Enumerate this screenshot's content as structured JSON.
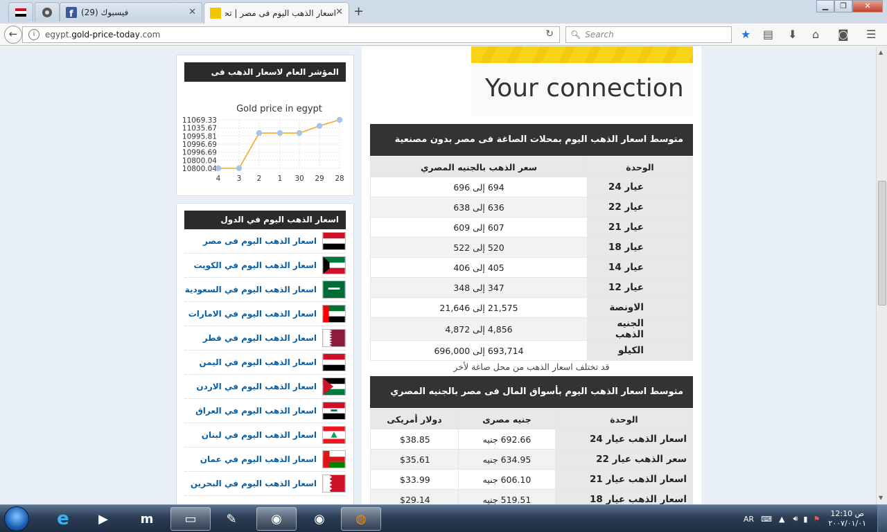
{
  "browser": {
    "tabs": [
      {
        "title": "",
        "favicon": "egypt-flag"
      },
      {
        "title": "",
        "favicon": "shield-icon"
      },
      {
        "title": "فيسبوك (29)",
        "favicon": "facebook-icon"
      },
      {
        "title": "اسعار الذهب اليوم فى مصر | تحديث",
        "favicon": "gold-square",
        "active": true
      }
    ],
    "url_prefix": "egypt.",
    "url_domain": "gold-price-today",
    "url_suffix": ".com",
    "search_placeholder": "Search"
  },
  "sidebar": {
    "chart_panel_title": "المؤشر العام لاسعار الذهب فى مصر",
    "countries_panel_title": "اسعار الذهب اليوم في الدول العربية",
    "countries": [
      {
        "label": "اسعار الذهب اليوم فى مصر",
        "flag": "egypt"
      },
      {
        "label": "اسعار الذهب اليوم في الكويت",
        "flag": "kuwait"
      },
      {
        "label": "اسعار الذهب اليوم في السعودية",
        "flag": "saudi"
      },
      {
        "label": "اسعار الذهب اليوم في الامارات",
        "flag": "uae"
      },
      {
        "label": "اسعار الذهب اليوم في قطر",
        "flag": "qatar"
      },
      {
        "label": "اسعار الذهب اليوم في اليمن",
        "flag": "yemen"
      },
      {
        "label": "اسعار الذهب اليوم في الاردن",
        "flag": "jordan"
      },
      {
        "label": "اسعار الذهب اليوم في العراق",
        "flag": "iraq"
      },
      {
        "label": "اسعار الذهب اليوم في لبنان",
        "flag": "lebanon"
      },
      {
        "label": "اسعار الذهب اليوم في عمان",
        "flag": "oman"
      },
      {
        "label": "اسعار الذهب اليوم في البحرين",
        "flag": "bahrain"
      }
    ]
  },
  "chart_data": {
    "type": "line",
    "title": "Gold price in egypt",
    "categories": [
      "4",
      "3",
      "2",
      "1",
      "30",
      "29",
      "28"
    ],
    "values": [
      10800.04,
      10800.04,
      10995.81,
      10995.81,
      10995.81,
      11035.67,
      11069.33
    ],
    "y_tick_labels": [
      "11069.33",
      "11035.67",
      "10995.81",
      "10996.69",
      "10996.69",
      "10800.04",
      "10800.04"
    ],
    "ylim": [
      10800.04,
      11069.33
    ],
    "grid": true,
    "line_color": "#f5a623",
    "point_color": "#a8c4e6"
  },
  "ad": {
    "text": "Your connection"
  },
  "shops_section": {
    "title": "متوسط اسعار الذهب اليوم بمحلات الصاغة فى مصر بدون مصنعية",
    "headers": [
      "الوحدة",
      "سعر الذهب بالجنيه المصري"
    ],
    "rows": [
      {
        "unit": "عيار 24",
        "price": "694 إلى 696"
      },
      {
        "unit": "عيار 22",
        "price": "636 إلى 638"
      },
      {
        "unit": "عيار 21",
        "price": "607 إلى 609"
      },
      {
        "unit": "عيار 18",
        "price": "520 إلى 522"
      },
      {
        "unit": "عيار 14",
        "price": "405 إلى 406"
      },
      {
        "unit": "عيار 12",
        "price": "347 إلى 348"
      },
      {
        "unit": "الاونصة",
        "price": "21,575 إلى 21,646"
      },
      {
        "unit": "الجنيه الذهب",
        "price": "4,856 إلى 4,872"
      },
      {
        "unit": "الكيلو",
        "price": "693,714 إلى 696,000"
      }
    ],
    "note": "قد تختلف اسعار الذهب من محل صاغة لأخر"
  },
  "markets_section": {
    "title": "متوسط اسعار الذهب اليوم بأسواق المال فى مصر بالجنيه المصري",
    "headers": [
      "الوحدة",
      "جنيه مصرى",
      "دولار أمريكى"
    ],
    "rows": [
      {
        "unit": "اسعار الذهب عيار 24",
        "egp": "692.66 جنيه",
        "usd": "$38.85"
      },
      {
        "unit": "سعر الذهب عيار 22",
        "egp": "634.95 جنيه",
        "usd": "$35.61"
      },
      {
        "unit": "اسعار الذهب عيار 21",
        "egp": "606.10 جنيه",
        "usd": "$33.99"
      },
      {
        "unit": "اسعار الذهب عيار 18",
        "egp": "519.51 جنيه",
        "usd": "$29.14"
      }
    ]
  },
  "taskbar": {
    "lang": "AR",
    "time": "ص 12:10",
    "date": "٢٠٠٧/٠١/٠١"
  }
}
